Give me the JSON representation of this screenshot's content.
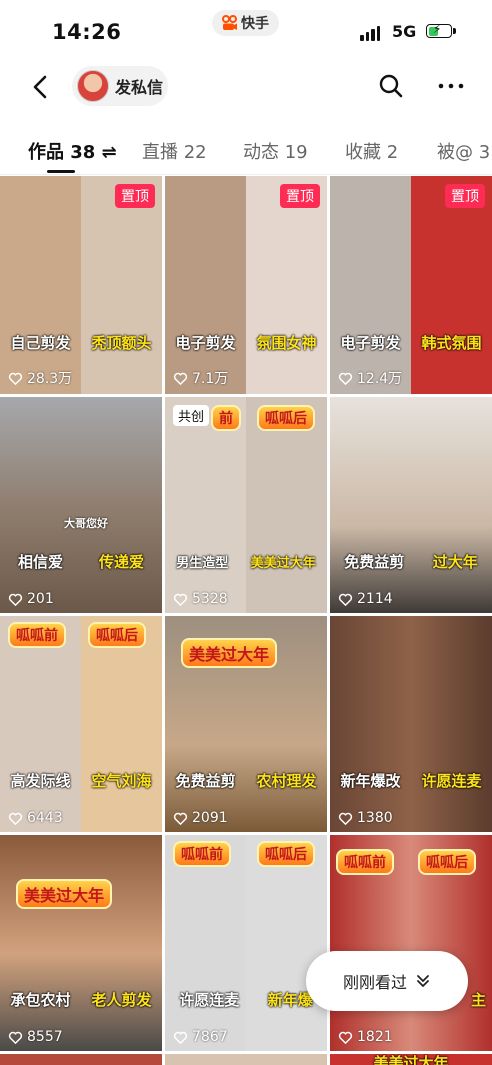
{
  "status": {
    "time": "14:26",
    "app_name": "快手",
    "network": "5G"
  },
  "nav": {
    "dm_label": "发私信"
  },
  "tabs": [
    {
      "label": "作品 38 ⇌"
    },
    {
      "label": "直播 22"
    },
    {
      "label": "动态 19"
    },
    {
      "label": "收藏 2"
    },
    {
      "label": "被@ 3"
    }
  ],
  "grid": [
    {
      "pinned": "置顶",
      "left": "自己剪发",
      "right": "秃顶额头",
      "likes": "28.3万"
    },
    {
      "pinned": "置顶",
      "left": "电子剪发",
      "right": "氛围女神",
      "likes": "7.1万"
    },
    {
      "pinned": "置顶",
      "left": "电子剪发",
      "right": "韩式氛围",
      "likes": "12.4万"
    },
    {
      "left": "相信爱",
      "right": "传递爱",
      "extra": "大哥您好",
      "likes": "201"
    },
    {
      "coop": "共创",
      "tag1": "前",
      "tag2": "呱呱后",
      "left": "男生造型",
      "right": "美美过大年",
      "likes": "5328"
    },
    {
      "left": "免费益剪",
      "right": "过大年",
      "likes": "2114"
    },
    {
      "tag1": "呱呱前",
      "tag2": "呱呱后",
      "left": "高发际线",
      "right": "空气刘海",
      "likes": "6443"
    },
    {
      "tag1": "美美过大年",
      "left": "免费益剪",
      "right": "农村理发",
      "likes": "2091"
    },
    {
      "left": "新年爆改",
      "right": "许愿连麦",
      "likes": "1380"
    },
    {
      "tag1": "美美过大年",
      "left": "承包农村",
      "right": "老人剪发",
      "likes": "8557"
    },
    {
      "tag1": "呱呱前",
      "tag2": "呱呱后",
      "left": "许愿连麦",
      "right": "新年爆",
      "likes": "7867"
    },
    {
      "tag1": "呱呱前",
      "tag2": "呱呱后",
      "left": "",
      "right": "主",
      "likes": "1821"
    }
  ],
  "bottom_row": {
    "partial": "美美过大年"
  },
  "toast": {
    "label": "刚刚看过"
  },
  "colors": {
    "pin": "#fe2c55",
    "caption_yellow": "#ffe31a"
  }
}
